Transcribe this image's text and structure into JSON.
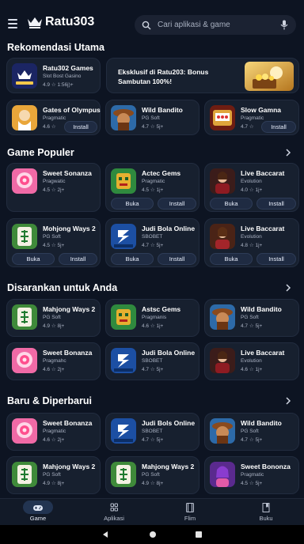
{
  "header": {
    "brand": "Ratu303",
    "search_placeholder": "Cari aplikasi & game",
    "icons": [
      "menu-icon",
      "crown-logo",
      "search-icon",
      "mic-icon"
    ]
  },
  "rekomendasi": {
    "title": "Rekomendasi Utama",
    "featured": {
      "name": "Ratu302 Games",
      "dev": "Slot Bost Gasino",
      "meta": "4.9 ☆ 1:56j)+"
    },
    "banner": {
      "text": "Eksklusif di Ratu203: Bonus Sambutan 100%!"
    },
    "apps": [
      {
        "name": "Gates of Olympus",
        "dev": "Pragmatic",
        "meta": "4.6 ☆",
        "button": "Install"
      },
      {
        "name": "Wild Bandito",
        "dev": "PG Soft",
        "meta": "4.7 ☆ 5j+",
        "button": ""
      },
      {
        "name": "Slow Gamna",
        "dev": "Pragmatic",
        "meta": "4.7 ☆",
        "button": "Install"
      }
    ]
  },
  "populer": {
    "title": "Game Populer",
    "apps": [
      {
        "name": "Sweet Sonanza",
        "dev": "Pragwatic",
        "meta": "4.5 ☆ 2j+",
        "b1": "",
        "b2": ""
      },
      {
        "name": "Actec Gems",
        "dev": "Pragmatic",
        "meta": "4.5 ☆ 1j+",
        "b1": "Buka",
        "b2": "Install"
      },
      {
        "name": "Live Baccarat",
        "dev": "Evolution",
        "meta": "4.0 ☆ 1j+",
        "b1": "Buka",
        "b2": "Install"
      },
      {
        "name": "Mohjong Ways 2",
        "dev": "PG Soft",
        "meta": "4.5 ☆ 5j+",
        "b1": "Buka",
        "b2": "Install"
      },
      {
        "name": "Judi Bola Online",
        "dev": "SBOBET",
        "meta": "4.7 ☆ 5j+",
        "b1": "Buka",
        "b2": "Install"
      },
      {
        "name": "Live Baccarat",
        "dev": "Evolution",
        "meta": "4.8 ☆ 1j+",
        "b1": "Buka",
        "b2": "Install"
      }
    ]
  },
  "disarankan": {
    "title": "Disarankan untuk Anda",
    "apps": [
      {
        "name": "Mahjong Ways 2",
        "dev": "PG Soft",
        "meta": "4.9 ☆ 8j+"
      },
      {
        "name": "Astsc Gems",
        "dev": "Pragmanis",
        "meta": "4.6 ☆ 1j+"
      },
      {
        "name": "Wild Bandito",
        "dev": "PG Soft",
        "meta": "4.7 ☆ 5j+"
      },
      {
        "name": "Sweet Bonanza",
        "dev": "Pragmahc",
        "meta": "4.6 ☆ 2j+"
      },
      {
        "name": "Judi Bola Online",
        "dev": "SBOBET",
        "meta": "4.7 ☆ 5j+"
      },
      {
        "name": "Live Baccarat",
        "dev": "Evolution",
        "meta": "4.6 ☆ 1j+"
      }
    ]
  },
  "baru": {
    "title": "Baru & Diperbarui",
    "apps": [
      {
        "name": "Sweet Bonanza",
        "dev": "Pragmatic",
        "meta": "4.6 ☆ 2j+"
      },
      {
        "name": "Judi Bols Online",
        "dev": "SBOBET",
        "meta": "4.7 ☆ 5j+"
      },
      {
        "name": "Wild Bandito",
        "dev": "PG Soft",
        "meta": "4.7 ☆ 5j+"
      },
      {
        "name": "Mahjong Ways 2",
        "dev": "PG Soft",
        "meta": "4.9 ☆ 8j+"
      },
      {
        "name": "Mahjong Ways 2",
        "dev": "PG Soft",
        "meta": "4.9 ☆ 8j+"
      },
      {
        "name": "Sweet Bononza",
        "dev": "Pragmatic",
        "meta": "4.5 ☆ 5j+"
      }
    ]
  },
  "nav": [
    {
      "label": "Game",
      "icon": "gamepad-icon",
      "active": true
    },
    {
      "label": "Aplikasi",
      "icon": "apps-grid-icon",
      "active": false
    },
    {
      "label": "Flim",
      "icon": "film-icon",
      "active": false
    },
    {
      "label": "Buku",
      "icon": "book-icon",
      "active": false
    }
  ],
  "colors": {
    "background": "#0d1422",
    "card": "#17202f",
    "accent": "#223451"
  }
}
